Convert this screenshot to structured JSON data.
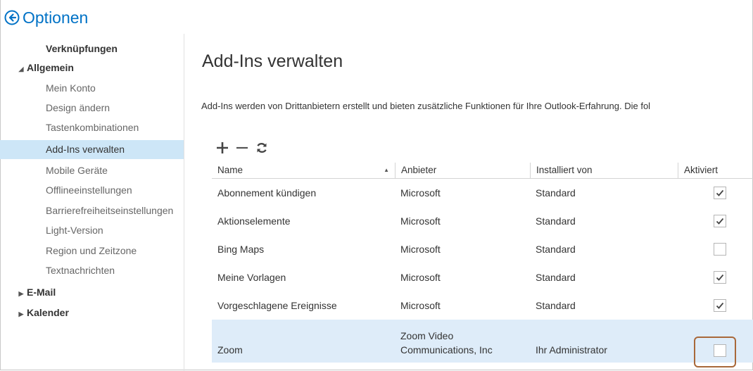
{
  "header": {
    "title": "Optionen"
  },
  "nav": [
    {
      "label": "Verknüpfungen",
      "kind": "top",
      "arrow": ""
    },
    {
      "label": "Allgemein",
      "kind": "top",
      "arrow": "◢"
    },
    {
      "label": "Mein Konto",
      "kind": "sub"
    },
    {
      "label": "Design ändern",
      "kind": "sub"
    },
    {
      "label": "Tastenkombinationen",
      "kind": "sub"
    },
    {
      "label": "Add-Ins verwalten",
      "kind": "sub",
      "selected": true
    },
    {
      "label": "Mobile Geräte",
      "kind": "sub"
    },
    {
      "label": "Offlineeinstellungen",
      "kind": "sub"
    },
    {
      "label": "Barrierefreiheitseinstellungen",
      "kind": "sub"
    },
    {
      "label": "Light-Version",
      "kind": "sub"
    },
    {
      "label": "Region und Zeitzone",
      "kind": "sub"
    },
    {
      "label": "Textnachrichten",
      "kind": "sub"
    },
    {
      "label": "E-Mail",
      "kind": "top",
      "arrow": "▶"
    },
    {
      "label": "Kalender",
      "kind": "top",
      "arrow": "▶"
    }
  ],
  "main": {
    "title": "Add-Ins verwalten",
    "intro": "Add-Ins werden von Drittanbietern erstellt und bieten zusätzliche Funktionen für Ihre Outlook-Erfahrung. Die fol"
  },
  "toolbar": {
    "add_icon": "plus-icon",
    "remove_icon": "minus-icon",
    "refresh_icon": "refresh-icon"
  },
  "table": {
    "columns": [
      "Name",
      "Anbieter",
      "Installiert von",
      "Aktiviert"
    ],
    "sort_indicator": "▲",
    "rows": [
      {
        "name": "Abonnement kündigen",
        "provider": "Microsoft",
        "installed_by": "Standard",
        "enabled": true
      },
      {
        "name": "Aktionselemente",
        "provider": "Microsoft",
        "installed_by": "Standard",
        "enabled": true
      },
      {
        "name": "Bing Maps",
        "provider": "Microsoft",
        "installed_by": "Standard",
        "enabled": false
      },
      {
        "name": "Meine Vorlagen",
        "provider": "Microsoft",
        "installed_by": "Standard",
        "enabled": true
      },
      {
        "name": "Vorgeschlagene Ereignisse",
        "provider": "Microsoft",
        "installed_by": "Standard",
        "enabled": true
      },
      {
        "name": "Zoom",
        "provider": "Zoom Video Communications, Inc",
        "installed_by": "Ihr Administrator",
        "enabled": false,
        "selected": true
      }
    ]
  },
  "colors": {
    "accent": "#0072c6",
    "selection": "#cde6f7",
    "row_selection": "#deecf9",
    "highlight_border": "#a8683a"
  }
}
